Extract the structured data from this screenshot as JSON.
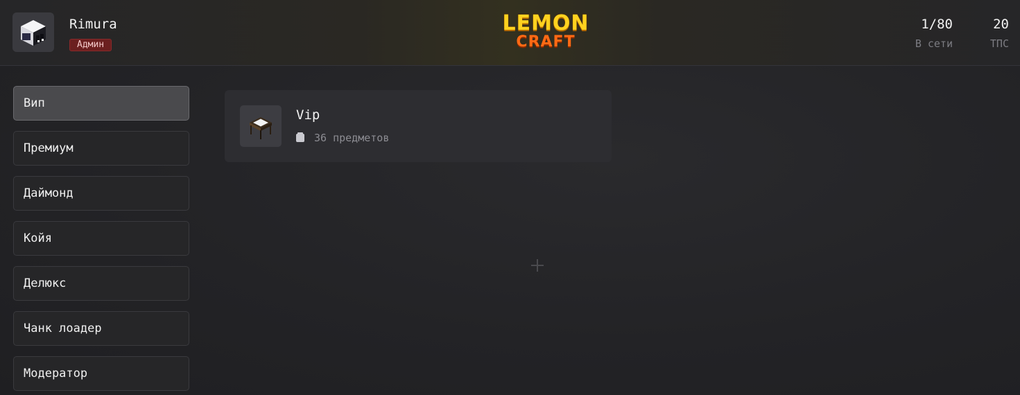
{
  "header": {
    "user": {
      "name": "Rimura",
      "role": "Админ"
    },
    "logo": {
      "top": "LEMON",
      "bottom": "CRAFT"
    },
    "stats": {
      "online": {
        "value": "1/80",
        "label": "В сети"
      },
      "tps": {
        "value": "20",
        "label": "ТПС"
      }
    }
  },
  "sidebar": {
    "items": [
      {
        "label": "Вип",
        "active": true
      },
      {
        "label": "Премиум"
      },
      {
        "label": "Даймонд"
      },
      {
        "label": "Койя"
      },
      {
        "label": "Делюкс"
      },
      {
        "label": "Чанк лоадер"
      },
      {
        "label": "Модератор"
      }
    ]
  },
  "main": {
    "kits": [
      {
        "title": "Vip",
        "items_text": "36 предметов",
        "icon": "table-block-icon"
      }
    ]
  },
  "colors": {
    "role_badge": "#6b1f1f",
    "logo_yellow": "#ffd21f",
    "logo_orange": "#ff6a14",
    "active_item": "#4a4a4d"
  }
}
